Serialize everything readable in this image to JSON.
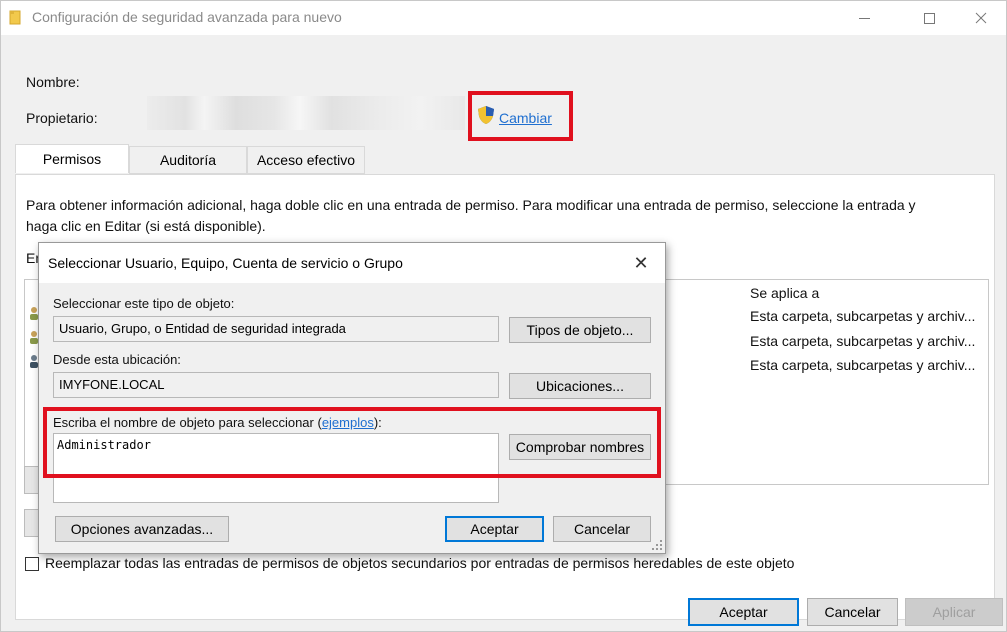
{
  "window": {
    "title": "Configuración de seguridad avanzada para nuevo",
    "icon": "folder-icon",
    "minimize_icon": "minimize-icon",
    "maximize_icon": "maximize-icon",
    "close_icon": "close-icon"
  },
  "header": {
    "name_label": "Nombre:",
    "owner_label": "Propietario:",
    "change_link": "Cambiar",
    "shield_icon": "uac-shield-icon"
  },
  "tabs": [
    {
      "label": "Permisos",
      "active": true
    },
    {
      "label": "Auditoría",
      "active": false
    },
    {
      "label": "Acceso efectivo",
      "active": false
    }
  ],
  "permissions": {
    "info_line1": "Para obtener información adicional, haga doble clic en una entrada de permiso. Para modificar una entrada de permiso, seleccione la entrada y",
    "info_line2": "haga clic en Editar (si está disponible).",
    "entries_label_fragment": "En",
    "column_applies_to": "Se aplica a",
    "rows": [
      {
        "applies_to": "Esta carpeta, subcarpetas y archiv..."
      },
      {
        "applies_to": "Esta carpeta, subcarpetas y archiv..."
      },
      {
        "applies_to": "Esta carpeta, subcarpetas y archiv..."
      }
    ],
    "replace_checkbox_label": "Reemplazar todas las entradas de permisos de objetos secundarios por entradas de permisos heredables de este objeto"
  },
  "footer": {
    "ok": "Aceptar",
    "cancel": "Cancelar",
    "apply": "Aplicar"
  },
  "dialog": {
    "title": "Seleccionar Usuario, Equipo, Cuenta de servicio o Grupo",
    "close_glyph": "✕",
    "object_type_label": "Seleccionar este tipo de objeto:",
    "object_type_value": "Usuario, Grupo, o Entidad de seguridad integrada",
    "object_types_button": "Tipos de objeto...",
    "location_label": "Desde esta ubicación:",
    "location_value": "IMYFONE.LOCAL",
    "locations_button": "Ubicaciones...",
    "enter_name_label_prefix": "Escriba el nombre de objeto para seleccionar (",
    "examples_link": "ejemplos",
    "enter_name_label_suffix": "):",
    "object_name_value": "Administrador",
    "check_names_button": "Comprobar nombres",
    "advanced_button": "Opciones avanzadas...",
    "ok_button": "Aceptar",
    "cancel_button": "Cancelar"
  },
  "colors": {
    "highlight_red": "#e0101e",
    "link_blue": "#1f6fd0",
    "primary_border": "#0078d7"
  }
}
